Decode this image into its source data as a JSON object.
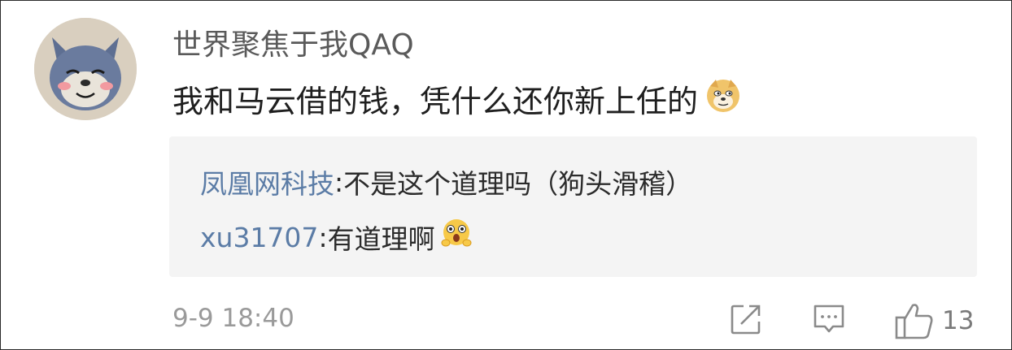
{
  "post": {
    "username": "世界聚焦于我QAQ",
    "comment_text": "我和马云借的钱，凭什么还你新上任的",
    "comment_emoji": "doge-emoji",
    "avatar": "cartoon-cat-avatar"
  },
  "replies": [
    {
      "author": "凤凰网科技",
      "separator": ":",
      "text": " 不是这个道理吗（狗头滑稽）"
    },
    {
      "author": "xu31707",
      "separator": ":",
      "text": " 有道理啊",
      "emoji": "shocked-face-emoji"
    }
  ],
  "footer": {
    "timestamp": "9-9 18:40",
    "share_icon": "share-icon",
    "comment_icon": "comment-icon",
    "like_icon": "thumbs-up-icon",
    "like_count": "13"
  },
  "colors": {
    "author_link": "#5b7ca6",
    "reply_background": "#f4f4f4",
    "meta_text": "#9a9a9a"
  }
}
